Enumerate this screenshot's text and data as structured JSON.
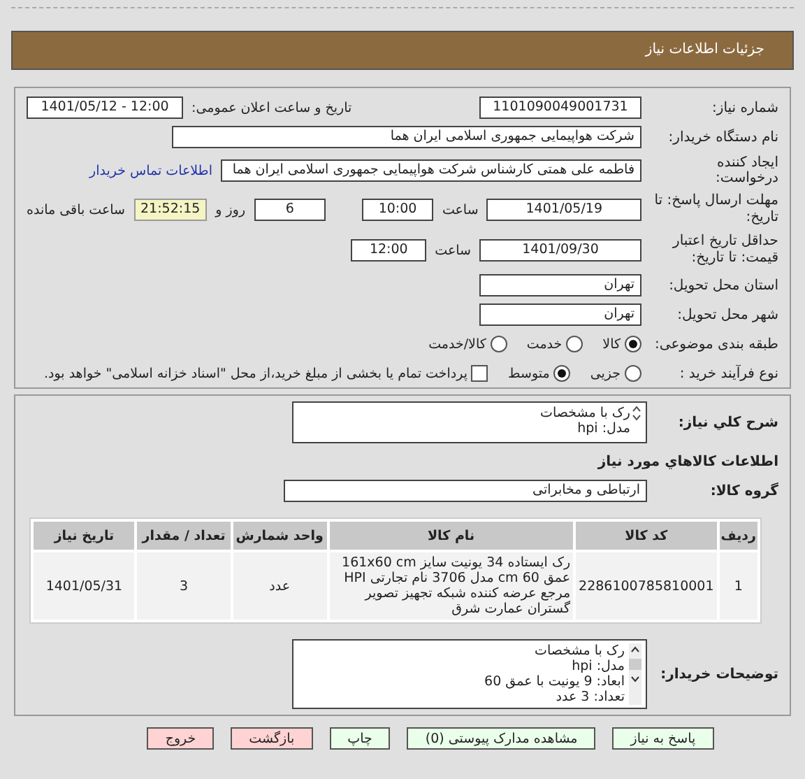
{
  "header": {
    "title": "جزئیات اطلاعات نیاز"
  },
  "need_number": {
    "label": "شماره نیاز:",
    "value": "1101090049001731"
  },
  "announce": {
    "label": "تاریخ و ساعت اعلان عمومی:",
    "value": "1401/05/12 - 12:00"
  },
  "buyer_org": {
    "label": "نام دستگاه خریدار:",
    "value": "شرکت هواپیمایی جمهوری اسلامی ایران هما"
  },
  "requester": {
    "label": "ایجاد کننده درخواست:",
    "value": "فاطمه علی همتی کارشناس شرکت هواپیمایی جمهوری اسلامی ایران هما",
    "link": "اطلاعات تماس خریدار"
  },
  "deadline": {
    "label": "مهلت ارسال پاسخ: تا تاریخ:",
    "date": "1401/05/19",
    "time_label": "ساعت",
    "time": "10:00",
    "days": "6",
    "days_label": "روز و",
    "remaining": "21:52:15",
    "remaining_label": "ساعت باقی مانده"
  },
  "validity": {
    "label": "حداقل تاریخ اعتبار قیمت: تا تاریخ:",
    "date": "1401/09/30",
    "time_label": "ساعت",
    "time": "12:00"
  },
  "province": {
    "label": "استان محل تحویل:",
    "value": "تهران"
  },
  "city": {
    "label": "شهر محل تحویل:",
    "value": "تهران"
  },
  "category": {
    "label": "طبقه بندی موضوعی:",
    "options": [
      {
        "label": "کالا",
        "selected": true
      },
      {
        "label": "خدمت",
        "selected": false
      },
      {
        "label": "کالا/خدمت",
        "selected": false
      }
    ]
  },
  "process": {
    "label": "نوع فرآیند خرید :",
    "options": [
      {
        "label": "جزیی",
        "selected": false
      },
      {
        "label": "متوسط",
        "selected": true
      }
    ],
    "payment": {
      "label": "پرداخت تمام یا بخشی از مبلغ خرید،از محل \"اسناد خزانه اسلامی\" خواهد بود.",
      "checked": false
    }
  },
  "summary": {
    "label": "شرح کلي نیاز:",
    "lines": [
      "رک با مشخصات",
      "مدل: hpi"
    ]
  },
  "goods_heading": "اطلاعات کالاهاي مورد نیاز",
  "goods_group": {
    "label": "گروه کالا:",
    "value": "ارتباطی و مخابراتی"
  },
  "table": {
    "columns": [
      "ردیف",
      "کد کالا",
      "نام کالا",
      "واحد شمارش",
      "تعداد / مقدار",
      "تاریخ نیاز"
    ],
    "rows": [
      [
        "1",
        "2286100785810001",
        "رک ایستاده 34 یونیت سایز 161x60 cm عمق 60 cm مدل 3706 نام تجارتی HPI مرجع عرضه کننده شبکه تجهیز تصویر گستران عمارت شرق",
        "عدد",
        "3",
        "1401/05/31"
      ]
    ]
  },
  "buyer_notes": {
    "label": "توضیحات خریدار:",
    "lines": [
      "رک با مشخصات",
      "مدل: hpi",
      "ابعاد: 9 یونیت با عمق 60",
      "تعداد: 3 عدد"
    ]
  },
  "buttons": [
    {
      "label": "پاسخ به نیاز",
      "kind": "primary"
    },
    {
      "label": "مشاهده مدارک پیوستی (0)",
      "kind": "primary"
    },
    {
      "label": "چاپ",
      "kind": "primary"
    },
    {
      "label": "بازگشت",
      "kind": "danger"
    },
    {
      "label": "خروج",
      "kind": "danger"
    }
  ]
}
